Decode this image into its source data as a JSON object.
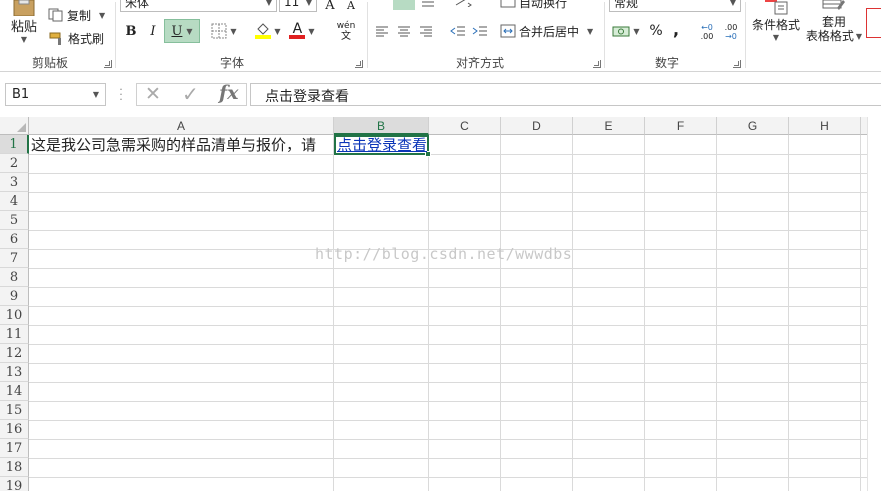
{
  "ribbon": {
    "clipboard": {
      "paste_label": "粘贴",
      "copy_label": "复制",
      "format_painter_label": "格式刷",
      "group_title": "剪贴板"
    },
    "font": {
      "font_name": "宋体",
      "font_size": "11",
      "grow_label": "A",
      "shrink_label": "A",
      "bold_label": "B",
      "italic_label": "I",
      "underline_label": "U",
      "font_color_letter": "A",
      "phonetic_label": "wén",
      "phonetic_sub": "文",
      "group_title": "字体",
      "highlight_color": "#ffff00",
      "font_color": "#e02020"
    },
    "alignment": {
      "wrap_label": "自动换行",
      "merge_label": "合并后居中",
      "group_title": "对齐方式"
    },
    "number": {
      "format_value": "常规",
      "percent_label": "%",
      "comma_label": ",",
      "inc_decimal_top": "←0",
      "inc_decimal_bottom": ".00",
      "dec_decimal_top": ".00",
      "dec_decimal_bottom": "→0",
      "group_title": "数字"
    },
    "styles": {
      "conditional_label": "条件格式",
      "table_label_1": "套用",
      "table_label_2": "表格格式"
    }
  },
  "formula_bar": {
    "name_box": "B1",
    "cancel_glyph": "✕",
    "enter_glyph": "✓",
    "fx_label": "fx",
    "content": "点击登录查看"
  },
  "grid": {
    "columns": [
      "A",
      "B",
      "C",
      "D",
      "E",
      "F",
      "G",
      "H"
    ],
    "selected_column": "B",
    "rows": [
      "1",
      "2",
      "3",
      "4",
      "5",
      "6",
      "7",
      "8",
      "9",
      "10",
      "11",
      "12",
      "13",
      "14",
      "15",
      "16",
      "17",
      "18",
      "19"
    ],
    "selected_row": "1",
    "a1": "这是我公司急需采购的样品清单与报价，请",
    "b1": "点击登录查看",
    "watermark": "http://blog.csdn.net/wwwdbs",
    "accent_color": "#217346",
    "link_color": "#0b35b8"
  }
}
